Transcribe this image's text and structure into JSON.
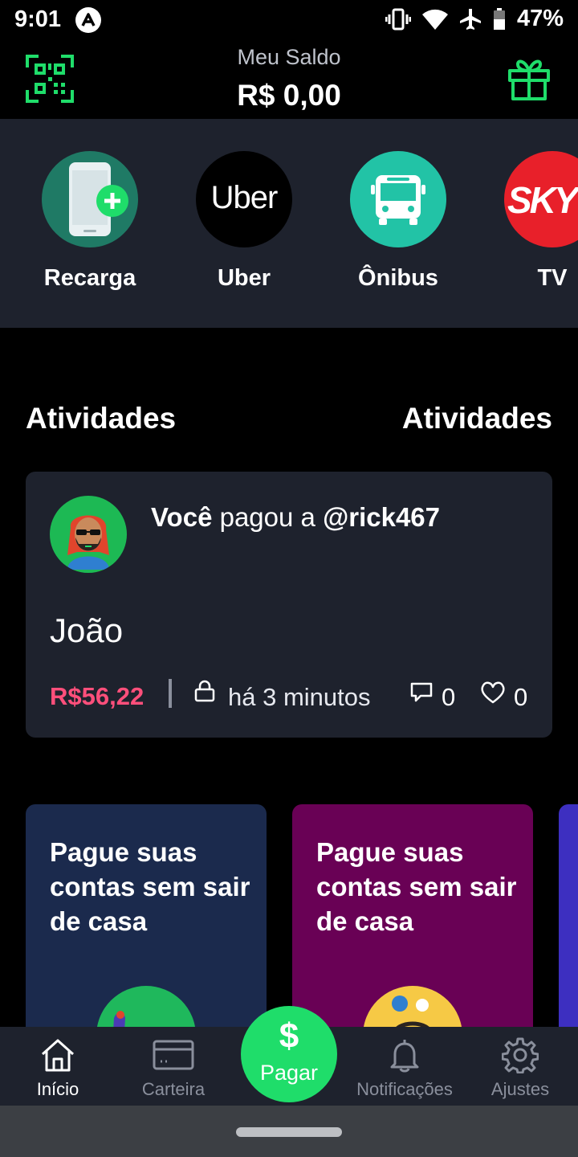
{
  "status_bar": {
    "time": "9:01",
    "battery": "47%"
  },
  "header": {
    "balance_label": "Meu Saldo",
    "balance_value": "R$ 0,00"
  },
  "services": [
    {
      "label": "Recarga",
      "icon": "phone-plus-icon",
      "color": "#1f7a65"
    },
    {
      "label": "Uber",
      "icon": "uber-logo",
      "logo_text": "Uber",
      "color": "#000000"
    },
    {
      "label": "Ônibus",
      "icon": "bus-icon",
      "color": "#22c3a6"
    },
    {
      "label": "TV",
      "icon": "sky-logo",
      "logo_text": "SKY",
      "color": "#e8202a"
    }
  ],
  "activities": {
    "title_left": "Atividades",
    "title_right": "Atividades",
    "items": [
      {
        "actor": "Você",
        "action": " pagou a ",
        "target": "@rick467",
        "name": "João",
        "amount": "R$56,22",
        "time": "há 3 minutos",
        "comments": "0",
        "likes": "0"
      }
    ]
  },
  "promos": [
    {
      "text": "Pague suas contas sem sair de casa",
      "color": "#1b2a4d"
    },
    {
      "text": "Pague suas contas sem sair de casa",
      "color": "#690155"
    }
  ],
  "bottom_nav": {
    "items": [
      {
        "label": "Início",
        "icon": "home-icon",
        "active": true
      },
      {
        "label": "Carteira",
        "icon": "wallet-icon",
        "active": false
      },
      {
        "label": "Notificações",
        "icon": "bell-icon",
        "active": false
      },
      {
        "label": "Ajustes",
        "icon": "gear-icon",
        "active": false
      }
    ],
    "pay": {
      "symbol": "$",
      "label": "Pagar"
    }
  },
  "colors": {
    "accent": "#1fdd6a",
    "amount": "#ff4f7b",
    "card_bg": "#1e222d"
  }
}
